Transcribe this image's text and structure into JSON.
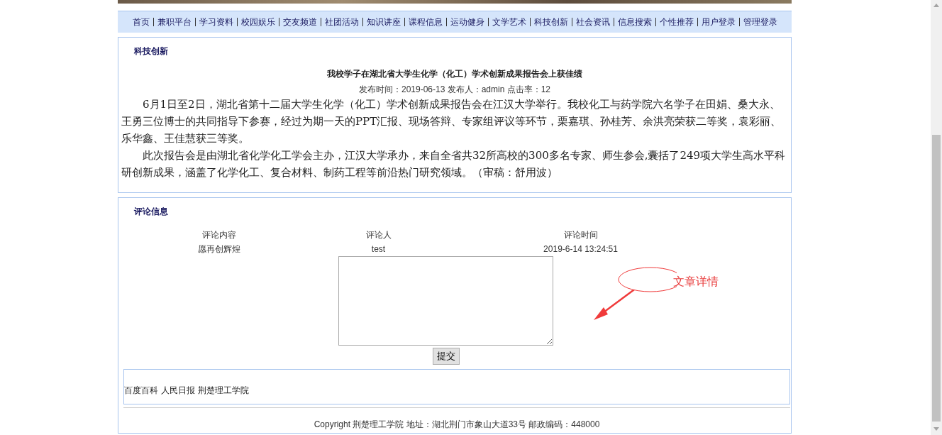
{
  "nav": {
    "items": [
      "首页",
      "兼职平台",
      "学习资料",
      "校园娱乐",
      "交友频道",
      "社团活动",
      "知识讲座",
      "课程信息",
      "运动健身",
      "文学艺术",
      "科技创新",
      "社会资讯",
      "信息搜索",
      "个性推荐",
      "用户登录",
      "管理登录"
    ]
  },
  "article": {
    "section": "科技创新",
    "title": "我校学子在湖北省大学生化学（化工）学术创新成果报告会上获佳绩",
    "meta": "发布时间：2019-06-13 发布人：admin 点击率：12",
    "paragraphs": [
      "6月1日至2日，湖北省第十二届大学生化学（化工）学术创新成果报告会在江汉大学举行。我校化工与药学院六名学子在田娟、桑大永、王勇三位博士的共同指导下参赛，经过为期一天的PPT汇报、现场答辩、专家组评议等环节，栗嘉琪、孙桂芳、余洪亮荣获二等奖，袁彩丽、乐华鑫、王佳慧获三等奖。",
      "此次报告会是由湖北省化学化工学会主办，江汉大学承办，来自全省共32所高校的300多名专家、师生参会,囊括了249项大学生高水平科研创新成果，涵盖了化学化工、复合材料、制药工程等前沿热门研究领域。（审稿：舒用波）"
    ]
  },
  "comments": {
    "section": "评论信息",
    "columns": [
      "评论内容",
      "评论人",
      "评论时间"
    ],
    "rows": [
      [
        "愿再创辉煌",
        "test",
        "2019-6-14 13:24:51"
      ]
    ],
    "submit": "提交"
  },
  "annotation": {
    "label": "文章详情"
  },
  "links": [
    "百度百科",
    "人民日报",
    "荆楚理工学院"
  ],
  "footer": "Copyright 荆楚理工学院 地址：湖北荆门市象山大道33号 邮政编码：448000"
}
